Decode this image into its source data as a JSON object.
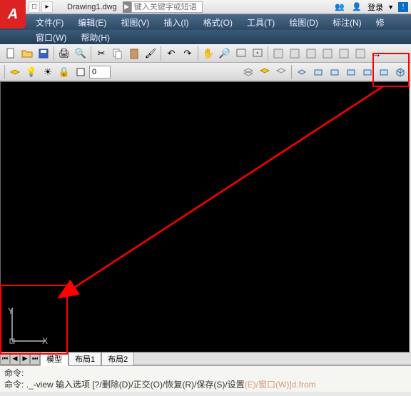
{
  "title": {
    "doc_name": "Drawing1.dwg",
    "search_placeholder": "键入关键字或短语",
    "login": "登录"
  },
  "menubar": {
    "items": [
      "文件(F)",
      "编辑(E)",
      "视图(V)",
      "插入(I)",
      "格式(O)",
      "工具(T)",
      "绘图(D)",
      "标注(N)",
      "修"
    ],
    "row2": [
      "窗口(W)",
      "帮助(H)"
    ]
  },
  "toolbar2": {
    "layer_value": "0"
  },
  "ucs": {
    "x": "X",
    "y": "Y"
  },
  "tabs": {
    "model": "模型",
    "layout1": "布局1",
    "layout2": "布局2"
  },
  "cmd": {
    "line1": "命令:",
    "line2_a": "命令: ._-view 输入选项 [?/删除(D)/正交(O)/恢复(R)/保存(S)/设置",
    "line2_b": "(E)/窗口(W)]d.from"
  }
}
